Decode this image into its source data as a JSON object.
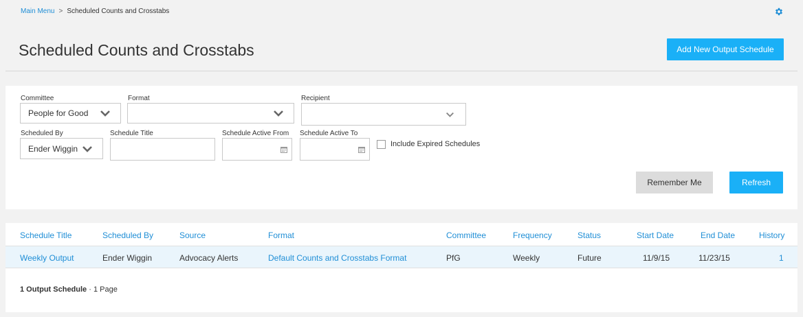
{
  "breadcrumb": {
    "home": "Main Menu",
    "separator": ">",
    "current": "Scheduled Counts and Crosstabs"
  },
  "page": {
    "title": "Scheduled Counts and Crosstabs",
    "add_button": "Add New Output Schedule"
  },
  "filters": {
    "committee": {
      "label": "Committee",
      "value": "People for Good"
    },
    "format": {
      "label": "Format",
      "value": ""
    },
    "recipient": {
      "label": "Recipient",
      "value": ""
    },
    "scheduled_by": {
      "label": "Scheduled By",
      "value": "Ender Wiggin"
    },
    "schedule_title": {
      "label": "Schedule Title",
      "value": ""
    },
    "active_from": {
      "label": "Schedule Active From",
      "value": ""
    },
    "active_to": {
      "label": "Schedule Active To",
      "value": ""
    },
    "include_expired": {
      "label": "Include Expired Schedules",
      "checked": false
    },
    "remember_button": "Remember Me",
    "refresh_button": "Refresh"
  },
  "table": {
    "columns": [
      "Schedule Title",
      "Scheduled By",
      "Source",
      "Format",
      "Committee",
      "Frequency",
      "Status",
      "Start Date",
      "End Date",
      "History"
    ],
    "rows": [
      [
        "Weekly Output",
        "Ender Wiggin",
        "Advocacy Alerts",
        "Default Counts and Crosstabs Format",
        "PfG",
        "Weekly",
        "Future",
        "11/9/15",
        "11/23/15",
        "1"
      ]
    ]
  },
  "summary": {
    "count": "1 Output Schedule",
    "separator": " · ",
    "pages": "1 Page"
  },
  "colors": {
    "accent": "#1ab0f7",
    "link": "#1f8ed6",
    "row_highlight": "#eaf5fc",
    "secondary_button": "#dcdcdc"
  }
}
